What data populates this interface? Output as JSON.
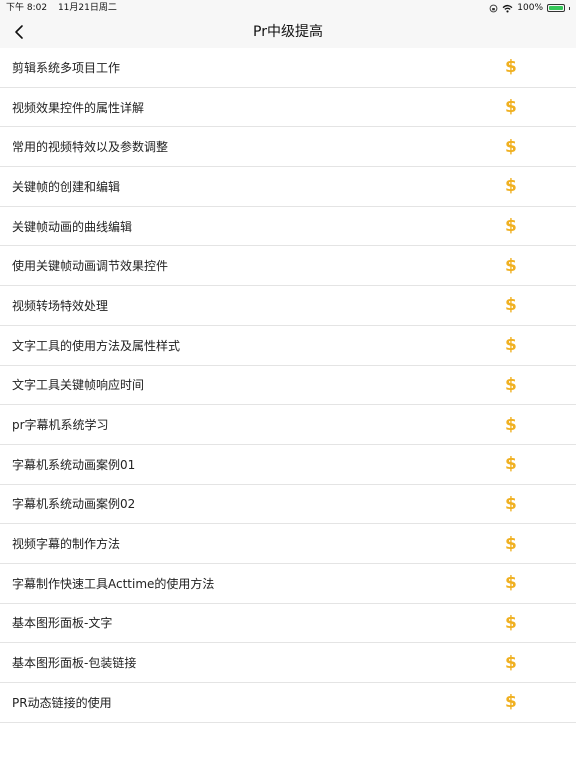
{
  "status_bar": {
    "time": "下午 8:02",
    "date": "11月21日周二",
    "battery": "100%",
    "battery_level": 1.0,
    "icons": [
      "lock-rotation-icon",
      "wifi-icon",
      "battery-icon"
    ]
  },
  "nav": {
    "title": "Pr中级提高",
    "back_icon": "chevron-left-icon"
  },
  "colors": {
    "accent": "#f0b020",
    "divider": "#e4e4e4",
    "nav_background": "#f7f7f7"
  },
  "items": [
    {
      "label": "剪辑系统多项目工作",
      "icon": "dollar-icon"
    },
    {
      "label": "视频效果控件的属性详解",
      "icon": "dollar-icon"
    },
    {
      "label": "常用的视频特效以及参数调整",
      "icon": "dollar-icon"
    },
    {
      "label": "关键帧的创建和编辑",
      "icon": "dollar-icon"
    },
    {
      "label": "关键帧动画的曲线编辑",
      "icon": "dollar-icon"
    },
    {
      "label": "使用关键帧动画调节效果控件",
      "icon": "dollar-icon"
    },
    {
      "label": "视频转场特效处理",
      "icon": "dollar-icon"
    },
    {
      "label": "文字工具的使用方法及属性样式",
      "icon": "dollar-icon"
    },
    {
      "label": "文字工具关键帧响应时间",
      "icon": "dollar-icon"
    },
    {
      "label": "pr字幕机系统学习",
      "icon": "dollar-icon"
    },
    {
      "label": "字幕机系统动画案例01",
      "icon": "dollar-icon"
    },
    {
      "label": "字幕机系统动画案例02",
      "icon": "dollar-icon"
    },
    {
      "label": "视频字幕的制作方法",
      "icon": "dollar-icon"
    },
    {
      "label": "字幕制作快速工具Acttime的使用方法",
      "icon": "dollar-icon"
    },
    {
      "label": "基本图形面板-文字",
      "icon": "dollar-icon"
    },
    {
      "label": "基本图形面板-包装链接",
      "icon": "dollar-icon"
    },
    {
      "label": "PR动态链接的使用",
      "icon": "dollar-icon"
    }
  ]
}
